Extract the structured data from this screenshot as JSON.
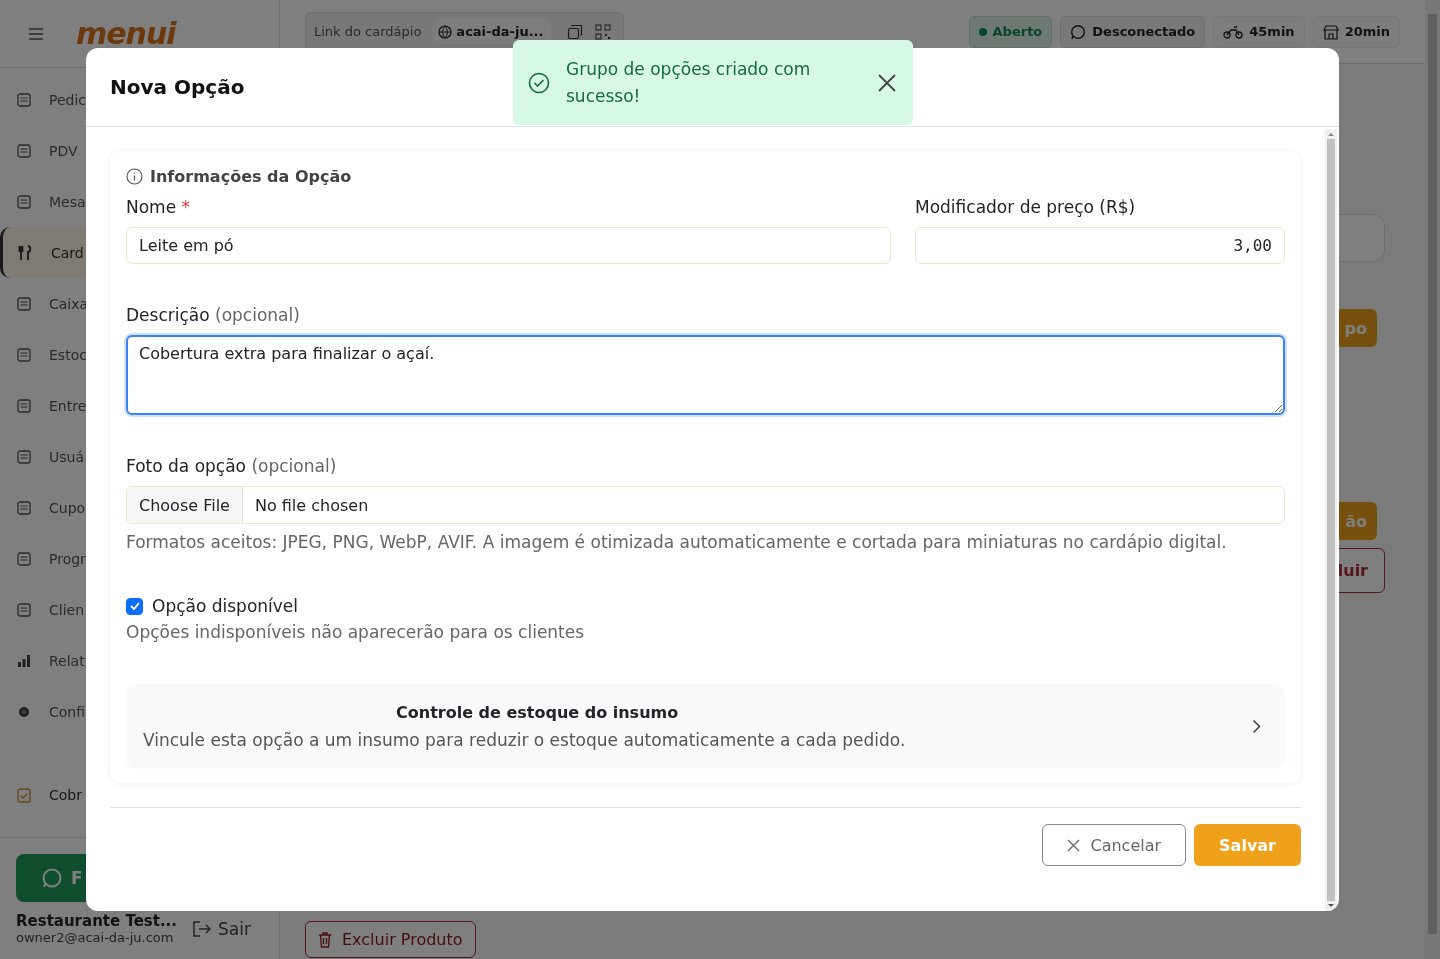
{
  "sidebar": {
    "logo": "menui",
    "items": [
      {
        "label": "Pedic",
        "selected": false
      },
      {
        "label": "PDV",
        "selected": false
      },
      {
        "label": "Mesa",
        "selected": false
      },
      {
        "label": "Card",
        "selected": true
      },
      {
        "label": "Caixa",
        "selected": false
      },
      {
        "label": "Estoc",
        "selected": false
      },
      {
        "label": "Entre",
        "selected": false
      },
      {
        "label": "Usuá",
        "selected": false
      },
      {
        "label": "Cupo",
        "selected": false
      },
      {
        "label": "Progr",
        "selected": false
      },
      {
        "label": "Clien",
        "selected": false
      },
      {
        "label": "Relat",
        "selected": false
      },
      {
        "label": "Confi",
        "selected": false
      },
      {
        "label": "Cobr",
        "selected": false
      }
    ],
    "whatsapp_button": "F",
    "account": {
      "name": "Restaurante Test...",
      "email": "owner2@acai-da-ju.com"
    },
    "logout": "Sair"
  },
  "topbar": {
    "link_label": "Link do cardápio",
    "link_value": "acai-da-ju...",
    "chips": [
      {
        "label": "Aberto",
        "kind": "status"
      },
      {
        "label": "Desconectado",
        "kind": "whatsapp"
      },
      {
        "label": "45min",
        "kind": "delivery"
      },
      {
        "label": "20min",
        "kind": "pickup"
      }
    ]
  },
  "background": {
    "buttons": [
      {
        "label": "po",
        "kind": "primary"
      },
      {
        "label": "ão",
        "kind": "primary"
      },
      {
        "label": "luir",
        "kind": "outline"
      }
    ],
    "delete_button": "Excluir Produto"
  },
  "modal": {
    "title": "Nova Opção",
    "section_title": "Informações da Opção",
    "name": {
      "label": "Nome",
      "required_mark": "*",
      "value": "Leite em pó"
    },
    "price": {
      "label": "Modificador de preço (R$)",
      "value": "3,00"
    },
    "description": {
      "label": "Descrição",
      "optional_note": "(opcional)",
      "value": "Cobertura extra para finalizar o açaí.",
      "focused": true
    },
    "photo": {
      "label": "Foto da opção",
      "optional_note": "(opcional)",
      "button": "Choose File",
      "status": "No file chosen",
      "hint": "Formatos aceitos: JPEG, PNG, WebP, AVIF. A imagem é otimizada automaticamente e cortada para miniaturas no cardápio digital."
    },
    "available": {
      "label": "Opção disponível",
      "checked": true,
      "hint": "Opções indisponíveis não aparecerão para os clientes"
    },
    "stock_link": {
      "title": "Controle de estoque do insumo",
      "description": "Vincule esta opção a um insumo para reduzir o estoque automaticamente a cada pedido."
    },
    "cancel_button": "Cancelar",
    "save_button": "Salvar"
  },
  "toast": {
    "message": "Grupo de opções criado com sucesso!"
  }
}
